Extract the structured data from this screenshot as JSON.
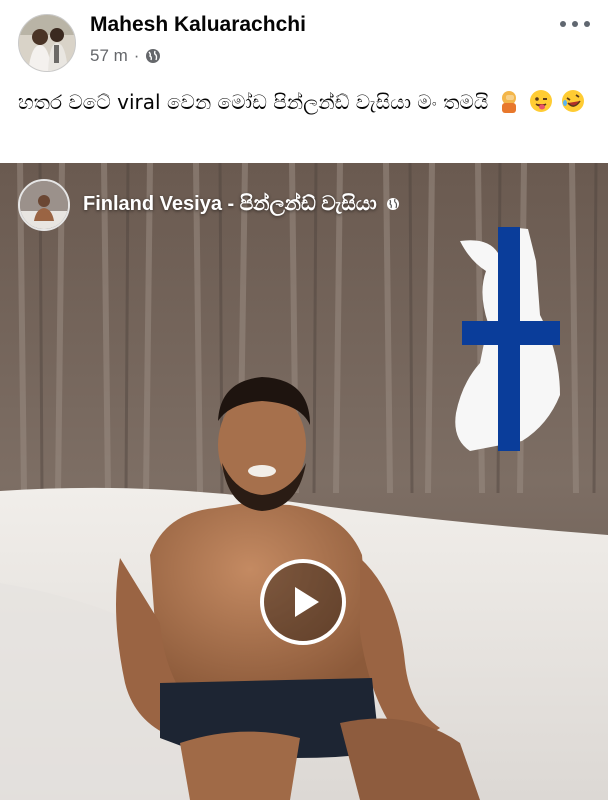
{
  "post": {
    "author": "Mahesh Kaluarachchi",
    "time": "57 m",
    "separator": "·",
    "audience_icon": "globe-icon",
    "more_icon": "more-options-icon",
    "caption": "හතර වටේ viral වෙන මෝඩ පින්ලන්ඩ් වැසියා මං තමයි",
    "caption_emojis": [
      "person-facepalming-emoji",
      "winking-face-with-tongue-emoji",
      "rolling-on-the-floor-laughing-emoji"
    ]
  },
  "shared": {
    "page_name": "Finland Vesiya - පින්ලන්ඩ් වැසියා",
    "audience_icon": "globe-icon",
    "overlay_icon": "finland-flag-map-icon",
    "play_icon": "play-icon"
  },
  "colors": {
    "text_primary": "#050505",
    "text_secondary": "#65676b",
    "finland_blue": "#0a3d9a",
    "snow": "#ece9e5"
  }
}
